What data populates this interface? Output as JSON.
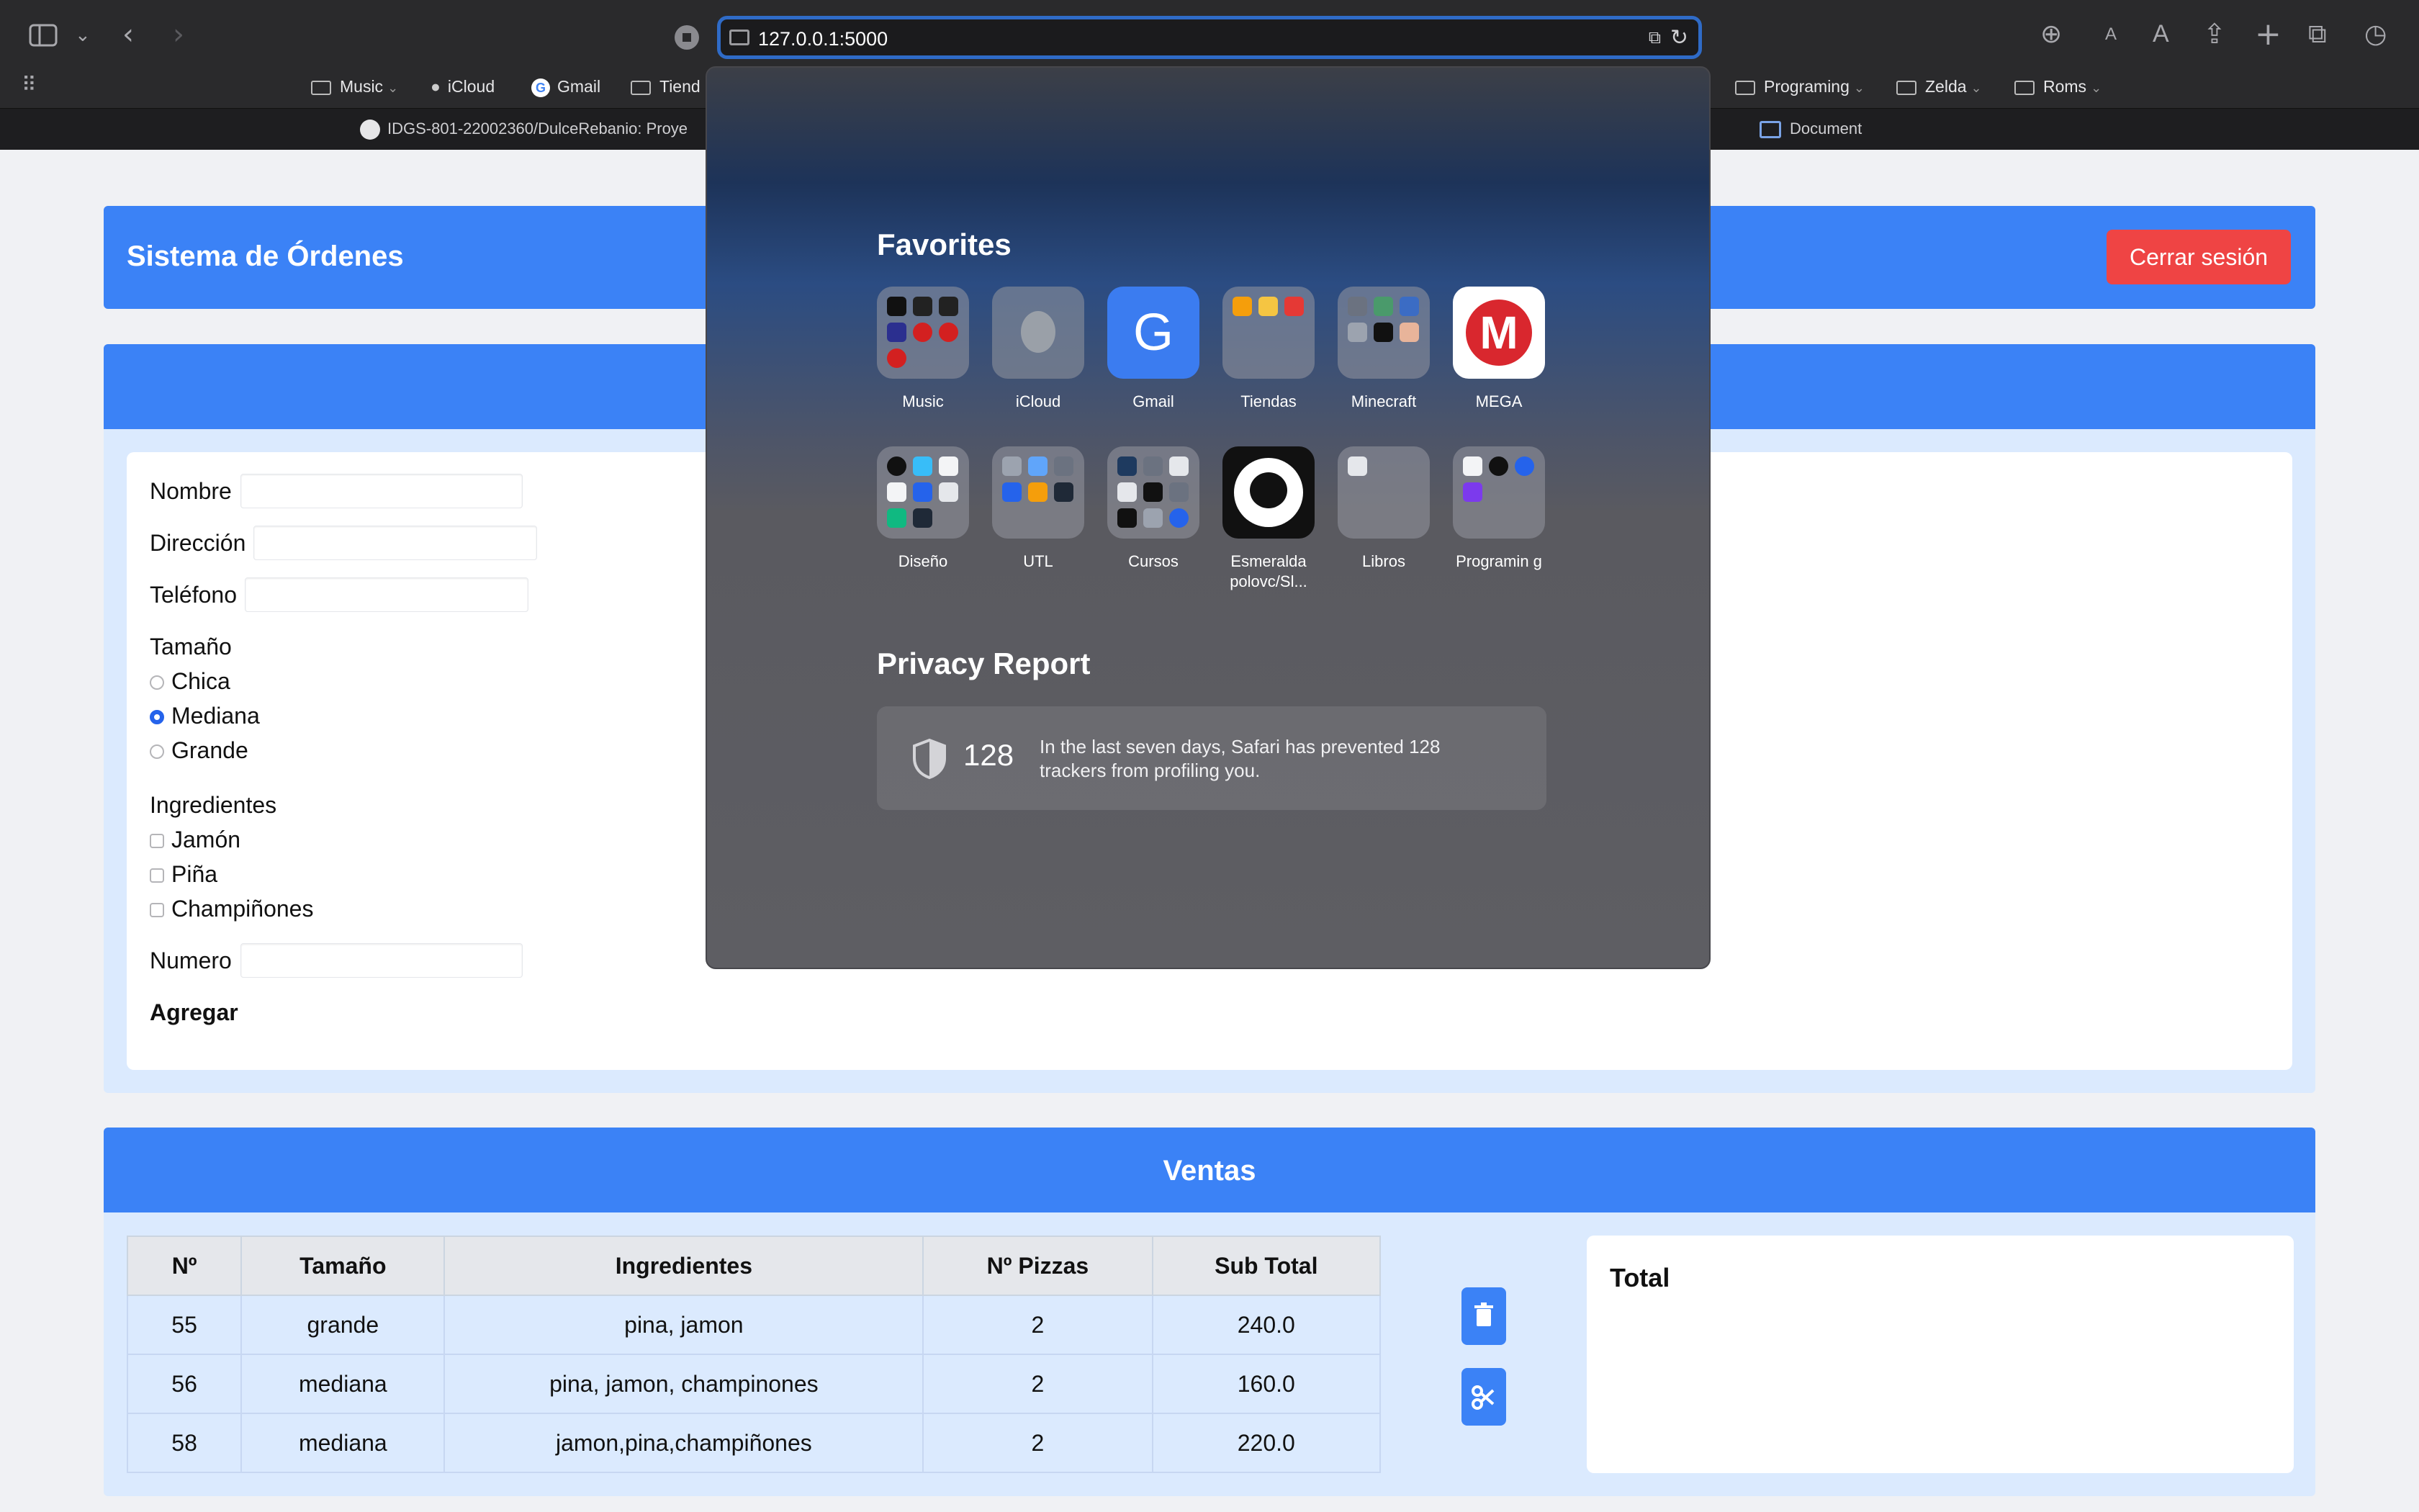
{
  "browser": {
    "url": "127.0.0.1:5000",
    "font_small": "A",
    "font_large": "A",
    "bookmarks": [
      {
        "label": "Music",
        "type": "folder"
      },
      {
        "label": "iCloud",
        "type": "apple"
      },
      {
        "label": "Gmail",
        "type": "google"
      },
      {
        "label": "Tiend",
        "type": "folder"
      },
      {
        "label": "Programing",
        "type": "folder"
      },
      {
        "label": "Zelda",
        "type": "folder"
      },
      {
        "label": "Roms",
        "type": "folder"
      }
    ],
    "tabs": [
      {
        "label": "IDGS-801-22002360/DulceRebanio: Proye",
        "icon": "github-icon"
      },
      {
        "label": "Document",
        "icon": "window-icon"
      }
    ]
  },
  "favorites_popover": {
    "favorites_title": "Favorites",
    "favorites": [
      {
        "name": "Music"
      },
      {
        "name": "iCloud"
      },
      {
        "name": "Gmail",
        "glyph": "G"
      },
      {
        "name": "Tiendas"
      },
      {
        "name": "Minecraft"
      },
      {
        "name": "MEGA",
        "glyph": "M"
      },
      {
        "name": "Diseño"
      },
      {
        "name": "UTL"
      },
      {
        "name": "Cursos"
      },
      {
        "name": "Esmeralda polovc/Sl..."
      },
      {
        "name": "Libros"
      },
      {
        "name": "Programin g"
      }
    ],
    "privacy_title": "Privacy Report",
    "privacy_count": "128",
    "privacy_message": "In the last seven days, Safari has prevented 128 trackers from profiling you."
  },
  "app": {
    "title": "Sistema de Órdenes",
    "logout_label": "Cerrar sesión"
  },
  "form": {
    "nombre_label": "Nombre",
    "direccion_label": "Dirección",
    "telefono_label": "Teléfono",
    "tamano_label": "Tamaño",
    "sizes": [
      "Chica",
      "Mediana",
      "Grande"
    ],
    "selected_size": "Mediana",
    "ingredientes_label": "Ingredientes",
    "ingredients": [
      "Jamón",
      "Piña",
      "Champiñones"
    ],
    "numero_label": "Numero",
    "add_label": "Agregar"
  },
  "ventas": {
    "title": "Ventas",
    "columns": [
      "Nº",
      "Tamaño",
      "Ingredientes",
      "Nº Pizzas",
      "Sub Total"
    ],
    "rows": [
      [
        "55",
        "grande",
        "pina, jamon",
        "2",
        "240.0"
      ],
      [
        "56",
        "mediana",
        "pina, jamon, champinones",
        "2",
        "160.0"
      ],
      [
        "58",
        "mediana",
        "jamon,pina,champiñones",
        "2",
        "220.0"
      ]
    ],
    "total_label": "Total"
  },
  "colors": {
    "primary": "#3b82f6",
    "danger": "#ef4444",
    "panel": "#dbeafe"
  }
}
